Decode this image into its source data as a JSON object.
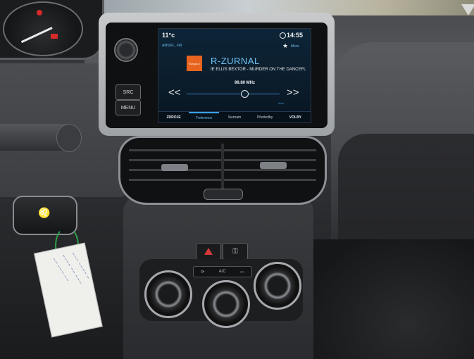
{
  "screen": {
    "outside_temp": "11°c",
    "clock": "14:55",
    "band_label": "AMS/FL. FM",
    "mem_label": "Mem.",
    "station_logo": "Evropa 2",
    "station_name": "R-ZURNAL",
    "radiotext": "IE ELLIS BEXTOR - MURDER ON THE DANCEFL",
    "frequency": "99.80 MHz",
    "auto_label": "Auto",
    "tabs": [
      "ZDROJE",
      "Frekvence",
      "Seznam",
      "Předvolby",
      "VOLBY"
    ],
    "active_tab": "Frekvence",
    "accent_color": "#3aa0e8"
  },
  "buttons": {
    "src_label": "SRC",
    "menu_label": "MENU"
  },
  "climate": {
    "recirc_label": "A/C"
  }
}
